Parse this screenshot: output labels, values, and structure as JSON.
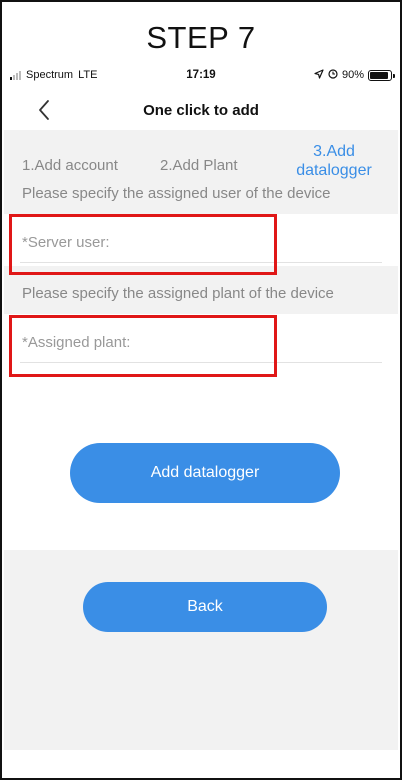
{
  "caption": {
    "step_title": "STEP 7"
  },
  "status_bar": {
    "carrier": "Spectrum",
    "network": "LTE",
    "time": "17:19",
    "battery": "90%",
    "battery_level": 0.9,
    "icons": [
      "signal-bars-icon",
      "location-arrow-icon",
      "alarm-clock-icon",
      "battery-icon"
    ]
  },
  "nav": {
    "title": "One click to add",
    "back_icon": "chevron-left-icon"
  },
  "steps": {
    "step1": "1.Add account",
    "step2": "2.Add Plant",
    "step3_line1": "3.Add",
    "step3_line2": "datalogger",
    "active_color": "#3a8ee6"
  },
  "form": {
    "user_hint": "Please specify the assigned user of the device",
    "server_user_label": "*Server user:",
    "plant_hint": "Please specify the assigned plant of the device",
    "assigned_plant_label": "*Assigned plant:"
  },
  "buttons": {
    "add_datalogger": "Add datalogger",
    "back": "Back"
  },
  "colors": {
    "accent": "#3a8ee6",
    "highlight": "#e01717",
    "background": "#f2f2f2"
  }
}
